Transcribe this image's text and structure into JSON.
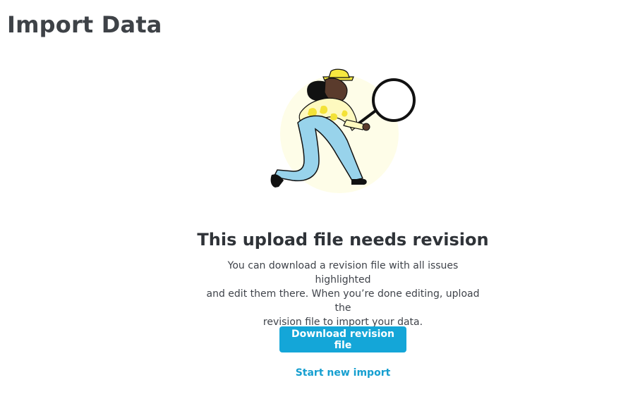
{
  "header": {
    "title": "Import Data"
  },
  "illustration": {
    "icon_name": "magnifying-person-illustration",
    "colors": {
      "circle_background": "#fefde8",
      "hat": "#f6e840",
      "pants": "#98d3eb",
      "shirt": "#fef9bf",
      "shirt_pattern": "#f3e238",
      "skin": "#5a3b2c",
      "outline": "#111111"
    }
  },
  "message": {
    "heading": "This upload file needs revision",
    "body_line_1": "You can download a revision file with all issues highlighted",
    "body_line_2": "and edit them there. When you’re done editing, upload the",
    "body_line_3": "revision file to import your data."
  },
  "actions": {
    "download_label": "Download revision file",
    "new_import_label": "Start new import"
  },
  "theme": {
    "accent": "#14a6d8",
    "link": "#169fd0"
  }
}
